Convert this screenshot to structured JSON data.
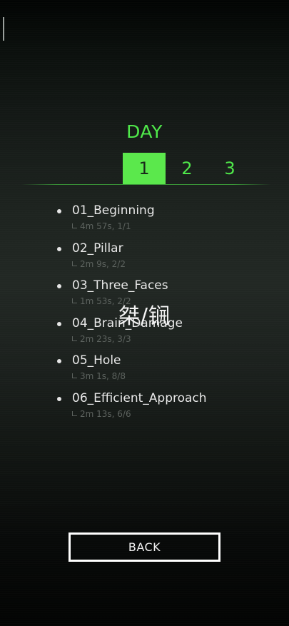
{
  "header": {
    "title": "DAY"
  },
  "day_tabs": [
    {
      "label": "1",
      "active": true
    },
    {
      "label": "2",
      "active": false
    },
    {
      "label": "3",
      "active": false
    }
  ],
  "levels": [
    {
      "name": "01_Beginning",
      "stat": "4m 57s, 1/1"
    },
    {
      "name": "02_Pillar",
      "stat": "2m 9s, 2/2"
    },
    {
      "name": "03_Three_Faces",
      "stat": "1m 53s, 2/2"
    },
    {
      "name": "04_Brain_Damage",
      "stat": "2m 23s, 3/3"
    },
    {
      "name": "05_Hole",
      "stat": "3m 1s, 8/8"
    },
    {
      "name": "06_Efficient_Approach",
      "stat": "2m 13s, 6/6"
    }
  ],
  "overlay_text": "桀/锎",
  "back_button": {
    "label": "BACK"
  },
  "colors": {
    "accent": "#4fe84a",
    "active_tab_bg": "#5be84c",
    "text": "#e8e8e8",
    "muted": "#5c625e"
  }
}
